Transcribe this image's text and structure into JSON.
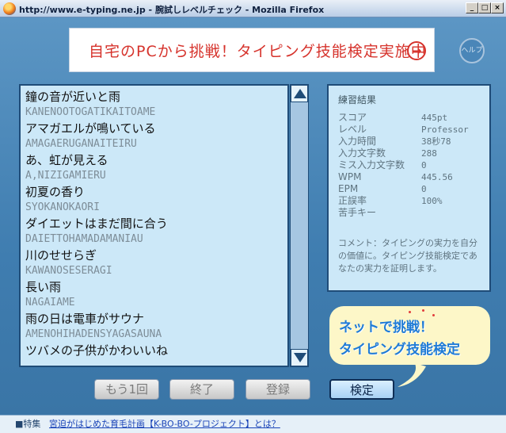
{
  "window": {
    "title": "http://www.e-typing.ne.jp - 腕試しレベルチェック - Mozilla Firefox",
    "minimize_label": "_",
    "maximize_label": "□",
    "close_label": "×"
  },
  "banner": {
    "text": "自宅のPCから挑戦！タイピング技能検定実施中",
    "arrow": "→"
  },
  "help": {
    "label": "ヘルプ"
  },
  "words": [
    {
      "jp": "鐘の音が近いと雨",
      "romaji": "KANENOOTOGATIKAITOAME"
    },
    {
      "jp": "アマガエルが鳴いている",
      "romaji": "AMAGAERUGANAITEIRU"
    },
    {
      "jp": "あ、虹が見える",
      "romaji": "A,NIZIGAMIERU"
    },
    {
      "jp": "初夏の香り",
      "romaji": "SYOKANOKAORI"
    },
    {
      "jp": "ダイエットはまだ間に合う",
      "romaji": "DAIETTOHAMADAMANIAU"
    },
    {
      "jp": "川のせせらぎ",
      "romaji": "KAWANOSESERAGI"
    },
    {
      "jp": "長い雨",
      "romaji": "NAGAIAME"
    },
    {
      "jp": "雨の日は電車がサウナ",
      "romaji": "AMENOHIHADENSYAGASAUNA"
    },
    {
      "jp": "ツバメの子供がかわいいね",
      "romaji": ""
    }
  ],
  "result": {
    "title": "練習結果",
    "rows": [
      {
        "label": "スコア",
        "value": "445pt"
      },
      {
        "label": "レベル",
        "value": "Professor"
      },
      {
        "label": "入力時間",
        "value": "38秒78"
      },
      {
        "label": "入力文字数",
        "value": "288"
      },
      {
        "label": "ミス入力文字数",
        "value": "0"
      },
      {
        "label": "WPM",
        "value": "445.56"
      },
      {
        "label": "EPM",
        "value": "0"
      },
      {
        "label": "正誤率",
        "value": "100%"
      },
      {
        "label": "苦手キー",
        "value": ""
      }
    ],
    "comment": "コメント：タイピングの実力を自分の価値に。タイピング技能検定であなたの実力を証明します。"
  },
  "callout": {
    "line1": "ネットで挑戦！",
    "line2": "タイピング技能検定"
  },
  "buttons": {
    "again": "もう1回",
    "end": "終了",
    "register": "登録",
    "check": "検定"
  },
  "footer": {
    "label": "■特集",
    "link": "宮迫がはじめた育毛計画【K-BO-BO-プロジェクト】とは？"
  },
  "colors": {
    "background": "#4a86b8",
    "panel": "#cce8f8",
    "banner_red": "#d6332c",
    "callout_blue": "#1f7bd6"
  }
}
